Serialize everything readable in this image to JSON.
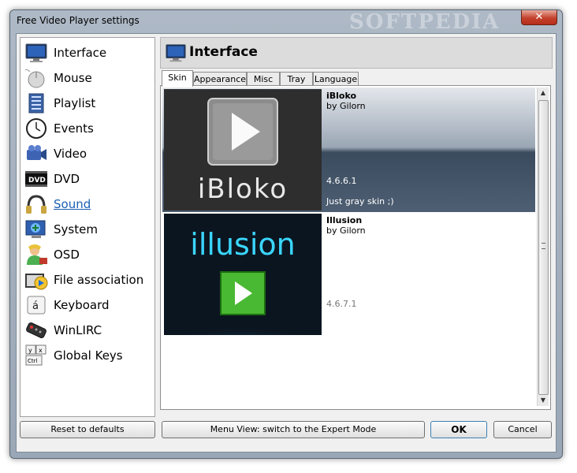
{
  "window": {
    "title": "Free Video Player settings",
    "watermark": "SOFTPEDIA"
  },
  "sidebar": {
    "items": [
      {
        "label": "Interface",
        "icon": "monitor-icon"
      },
      {
        "label": "Mouse",
        "icon": "mouse-icon"
      },
      {
        "label": "Playlist",
        "icon": "playlist-icon"
      },
      {
        "label": "Events",
        "icon": "clock-icon"
      },
      {
        "label": "Video",
        "icon": "camera-icon"
      },
      {
        "label": "DVD",
        "icon": "dvd-icon"
      },
      {
        "label": "Sound",
        "icon": "headphones-icon"
      },
      {
        "label": "System",
        "icon": "system-icon"
      },
      {
        "label": "OSD",
        "icon": "osd-icon"
      },
      {
        "label": "File association",
        "icon": "file-association-icon"
      },
      {
        "label": "Keyboard",
        "icon": "keyboard-icon",
        "glyph": "á"
      },
      {
        "label": "WinLIRC",
        "icon": "remote-icon"
      },
      {
        "label": "Global Keys",
        "icon": "global-keys-icon",
        "keys": [
          "y",
          "x",
          "Ctrl"
        ]
      }
    ]
  },
  "panel": {
    "title": "Interface"
  },
  "tabs": [
    "Skin",
    "Appearance",
    "Misc",
    "Tray",
    "Language"
  ],
  "skins": [
    {
      "name": "iBloko",
      "author": "by Gilorn",
      "version": "4.6.6.1",
      "description": "Just gray skin ;)",
      "logo": "iBloko"
    },
    {
      "name": "Illusion",
      "author": "by Gilorn",
      "version": "4.6.7.1",
      "description": "",
      "logo": "illusion"
    }
  ],
  "buttons": {
    "reset": "Reset to defaults",
    "menu_view": "Menu View: switch to the Expert Mode",
    "ok": "OK",
    "cancel": "Cancel"
  },
  "colors": {
    "link": "#1a5fb4",
    "selected_row": "#3a4a5c",
    "illusion_glow": "#3ad6ff",
    "play_green": "#49b832"
  }
}
